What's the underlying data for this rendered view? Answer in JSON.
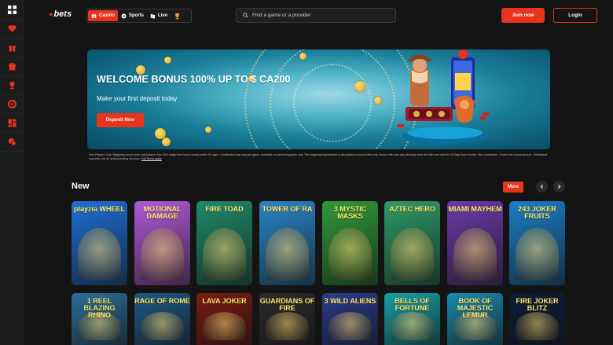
{
  "brand": {
    "logo_mark": "●",
    "logo_text": "bets",
    "accent": "#e8341c"
  },
  "rail": {
    "items": [
      "grid-icon",
      "heart-icon",
      "gift-icon",
      "gift-box-icon",
      "trophy-icon",
      "lifebuoy-icon",
      "apps-icon",
      "chat-icon"
    ]
  },
  "nav": {
    "casino": "Casino",
    "sports": "Sports",
    "live": "Live"
  },
  "search": {
    "placeholder": "Find a game or a provider"
  },
  "auth": {
    "join": "Join now",
    "login": "Login"
  },
  "banner": {
    "title": "WELCOME BONUS 100% UP TO $ CA200",
    "subtitle": "Make your first deposit today",
    "cta": "Deposit Now"
  },
  "terms": {
    "text": "New Players Only. Wagering occurs from real balance first. 50X wager the bonus money within 30 days. Contribution may vary per game. Available on selected games only. The wagering requirement is calculated on bonus bets only. Bonus offer and any winnings from the offer are valid for 30 Days from receipt. Max conversion: 3 times the bonus amount. Withdrawal requests void all active/pending bonuses.",
    "link": "Full Terms apply"
  },
  "section": {
    "title": "New",
    "more": "More"
  },
  "games_row1": [
    {
      "name": "playzia WHEEL",
      "bg": "#1d6fd6"
    },
    {
      "name": "MOTIONAL DAMAGE",
      "bg": "#b05ad8"
    },
    {
      "name": "FIRE TOAD",
      "bg": "#1f8a6a"
    },
    {
      "name": "TOWER OF RA",
      "bg": "#2a86c7"
    },
    {
      "name": "3 MYSTIC MASKS",
      "bg": "#2f9a3a"
    },
    {
      "name": "AZTEC HERO",
      "bg": "#2f9a68"
    },
    {
      "name": "MIAMI MAYHEM",
      "bg": "#6c3aa8"
    },
    {
      "name": "243 JOKER FRUITS",
      "bg": "#1a7ec8"
    }
  ],
  "games_row2": [
    {
      "name": "1 REEL BLAZING RHINO",
      "bg": "#2a6f9a"
    },
    {
      "name": "RAGE OF ROME",
      "bg": "#1d5a86"
    },
    {
      "name": "LAVA JOKER",
      "bg": "#7a1a12"
    },
    {
      "name": "GUARDIANS OF FIRE",
      "bg": "#2b2b2b"
    },
    {
      "name": "3 WILD ALIENS",
      "bg": "#2a3c8c"
    },
    {
      "name": "BELLS OF FORTUNE",
      "bg": "#17a0a8"
    },
    {
      "name": "BOOK OF MAJESTIC LEMUR",
      "bg": "#1a8ab0"
    },
    {
      "name": "FIRE JOKER BLITZ",
      "bg": "#0c1c3a"
    }
  ]
}
